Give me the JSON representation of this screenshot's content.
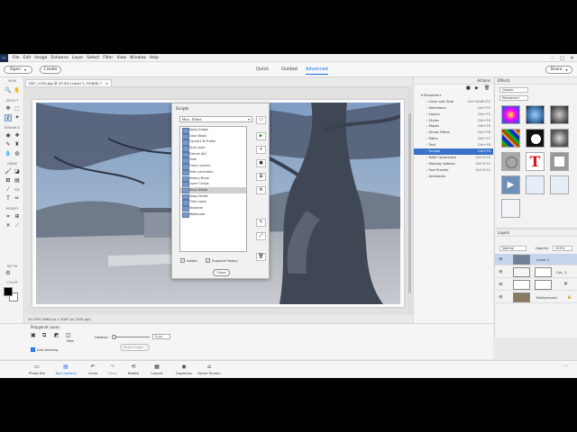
{
  "menu": [
    "File",
    "Edit",
    "Image",
    "Enhance",
    "Layer",
    "Select",
    "Filter",
    "View",
    "Window",
    "Help"
  ],
  "window_controls": [
    "–",
    "□",
    "✕"
  ],
  "topbar": {
    "open_label": "Open",
    "create_label": "Create",
    "modes": [
      "Quick",
      "Guided",
      "Advanced"
    ],
    "active_mode": "Advanced",
    "share_label": "Share"
  },
  "toolbar": {
    "sections": [
      "VIEW",
      "SELECT",
      "ENHANCE",
      "DRAW",
      "MODIFY",
      "SET IN",
      "COLOR"
    ]
  },
  "document": {
    "tab_title": "DSC_1120.jpg @ 20.4% (Layer 1, RGB/8) *",
    "tab_close": "×",
    "status": "20.39%     2664 px x 2087 px (300 ppi)"
  },
  "scripts_dialog": {
    "title": "Scripts",
    "category": "Misc. Effect",
    "items": [
      "Apply Image",
      "Color Boost",
      "Convert To Profile",
      "Dual Layer",
      "Extract AIQ",
      "Fade",
      "Fuzzy Layouts",
      "Hide Luminosity",
      "History Brush",
      "Layer Comps",
      "Ninja Stamp",
      "Sharp Finder",
      "Time Lapse",
      "Vectorize",
      "Watercolor"
    ],
    "selected_index": 10,
    "side_buttons": [
      "▭",
      "▶",
      "+",
      "●",
      "⧉",
      "⚙",
      "✎",
      "⤢",
      "🗑"
    ],
    "check_isolate": "Isolate",
    "check_suspend": "Suspend History",
    "close_label": "Close"
  },
  "actions": {
    "tab": "Actions",
    "root": "Elements+",
    "rows": [
      {
        "label": "Color and Tone",
        "shortcut": "Ctrl+Shift+F2"
      },
      {
        "label": "Selections",
        "shortcut": "Ctrl+F2"
      },
      {
        "label": "Layers",
        "shortcut": "Ctrl+F3"
      },
      {
        "label": "Styles",
        "shortcut": "Ctrl+F4"
      },
      {
        "label": "Masks",
        "shortcut": "Ctrl+F5"
      },
      {
        "label": "Smart Filters",
        "shortcut": "Ctrl+F6"
      },
      {
        "label": "Paths",
        "shortcut": "Ctrl+F7"
      },
      {
        "label": "Text",
        "shortcut": "Ctrl+F8"
      },
      {
        "label": "Scripts",
        "shortcut": "Ctrl+F9"
      },
      {
        "label": "RAW Corrections",
        "shortcut": "Ctrl+F10"
      },
      {
        "label": "Missing Options",
        "shortcut": "Ctrl+F11"
      },
      {
        "label": "Tool Presets",
        "shortcut": "Ctrl+F12"
      },
      {
        "label": "Animation",
        "shortcut": ""
      }
    ],
    "highlight_index": 8
  },
  "effects": {
    "tab": "Effects",
    "category": "Classic",
    "library": "Elements+"
  },
  "layers": {
    "tab": "Layers",
    "blend_mode": "Normal",
    "opacity_label": "Opacity:",
    "opacity_value": "100%",
    "rows": [
      {
        "name": "Layer 1",
        "selected": true
      },
      {
        "name": "Col...1",
        "selected": false
      },
      {
        "name": "",
        "selected": false
      },
      {
        "name": "Background",
        "selected": false
      }
    ]
  },
  "tool_options": {
    "tool_name": "Polygonal Lasso",
    "new_label": "New",
    "feather_label": "Feather:",
    "feather_value": "0 px",
    "refine_label": "Refine Edge...",
    "antialias_label": "Anti-aliasing"
  },
  "bottom_bar": {
    "items": [
      "Photo Bin",
      "Tool Options",
      "Undo",
      "Redo",
      "Rotate",
      "Layout",
      "Organizer",
      "Home Screen"
    ],
    "active": "Tool Options"
  }
}
